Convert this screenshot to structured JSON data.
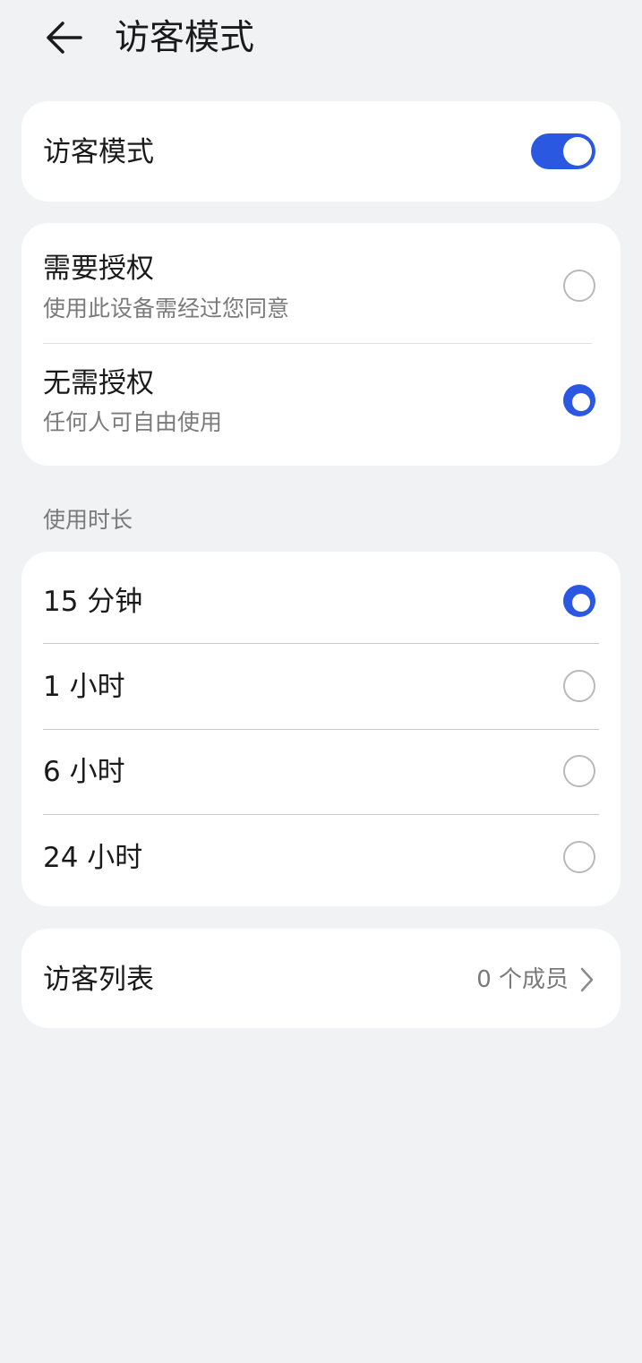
{
  "header": {
    "title": "访客模式",
    "back_icon": "arrow-left-icon"
  },
  "guest_mode": {
    "label": "访客模式",
    "enabled": true
  },
  "authorization": {
    "options": [
      {
        "label": "需要授权",
        "description": "使用此设备需经过您同意",
        "selected": false
      },
      {
        "label": "无需授权",
        "description": "任何人可自由使用",
        "selected": true
      }
    ]
  },
  "duration": {
    "section_label": "使用时长",
    "options": [
      {
        "label": "15 分钟",
        "selected": true
      },
      {
        "label": "1 小时",
        "selected": false
      },
      {
        "label": "6 小时",
        "selected": false
      },
      {
        "label": "24 小时",
        "selected": false
      }
    ]
  },
  "guest_list": {
    "label": "访客列表",
    "value": "0 个成员",
    "icon": "chevron-right-icon"
  },
  "colors": {
    "accent": "#2a58e0",
    "background": "#f1f2f4",
    "card": "#ffffff",
    "secondary_text": "#7a7a7a"
  }
}
